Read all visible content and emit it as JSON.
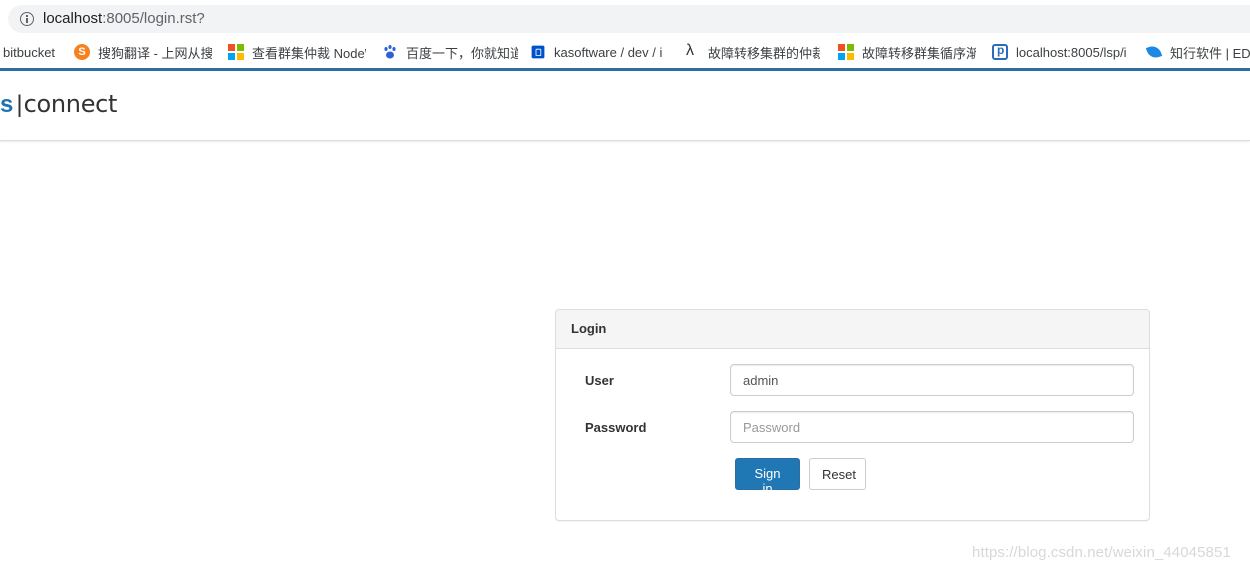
{
  "browser": {
    "url_host": "localhost",
    "url_path": ":8005/login.rst?",
    "bookmarks": [
      {
        "label": "bitbucket",
        "icon": "none"
      },
      {
        "label": "搜狗翻译 - 上网从搜狗",
        "icon": "sogou-icon"
      },
      {
        "label": "查看群集仲裁 NodeW",
        "icon": "microsoft-icon"
      },
      {
        "label": "百度一下，你就知道",
        "icon": "baidu-paw-icon"
      },
      {
        "label": "kasoftware / dev / i",
        "icon": "bitbucket-icon"
      },
      {
        "label": "故障转移集群的仲裁",
        "icon": "lambda-icon"
      },
      {
        "label": "故障转移群集循序渐进",
        "icon": "microsoft-icon"
      },
      {
        "label": "localhost:8005/lsp/i",
        "icon": "p-icon"
      },
      {
        "label": "知行软件 | EDI",
        "icon": "leaf-icon"
      }
    ]
  },
  "app": {
    "brand_mark": "s",
    "brand_separator": "|",
    "brand_name": "connect",
    "brand_color": "#1c73b3"
  },
  "login": {
    "title": "Login",
    "user_label": "User",
    "user_value": "admin",
    "password_label": "Password",
    "password_placeholder": "Password",
    "signin_label": "Sign in",
    "reset_label": "Reset",
    "primary_color": "#1f77b4"
  },
  "watermark": "https://blog.csdn.net/weixin_44045851"
}
